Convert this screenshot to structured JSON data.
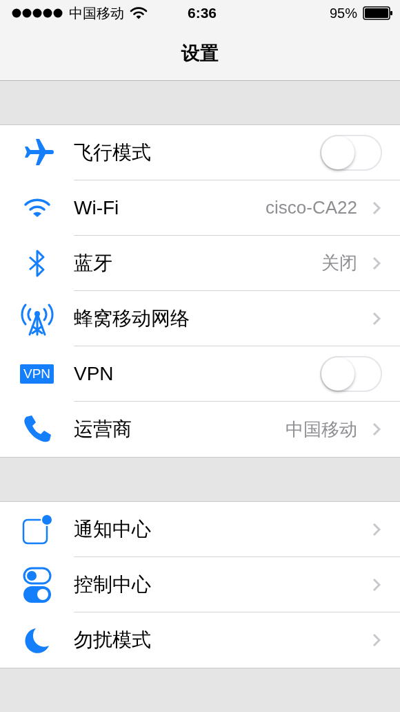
{
  "status_bar": {
    "carrier": "中国移动",
    "time": "6:36",
    "battery": "95%"
  },
  "nav_bar": {
    "title": "设置"
  },
  "groups": [
    {
      "rows": [
        {
          "label": "飞行模式",
          "kind": "toggle",
          "on": false
        },
        {
          "label": "Wi-Fi",
          "kind": "link",
          "value": "cisco-CA22"
        },
        {
          "label": "蓝牙",
          "kind": "link",
          "value": "关闭"
        },
        {
          "label": "蜂窝移动网络",
          "kind": "link"
        },
        {
          "label": "VPN",
          "kind": "toggle",
          "on": false,
          "badge": "VPN"
        },
        {
          "label": "运营商",
          "kind": "link",
          "value": "中国移动"
        }
      ]
    },
    {
      "rows": [
        {
          "label": "通知中心",
          "kind": "link"
        },
        {
          "label": "控制中心",
          "kind": "link"
        },
        {
          "label": "勿扰模式",
          "kind": "link"
        }
      ]
    }
  ]
}
